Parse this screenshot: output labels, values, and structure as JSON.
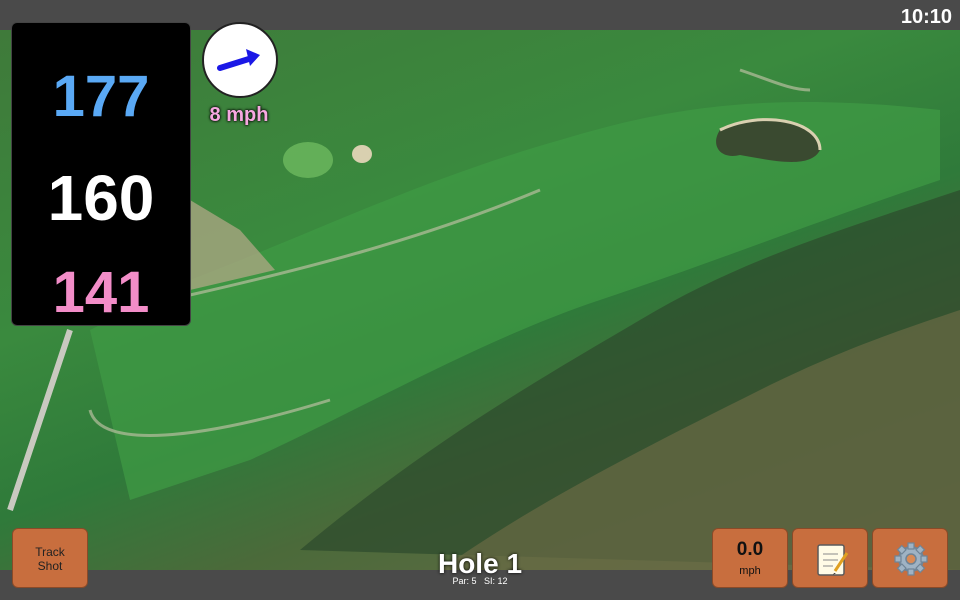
{
  "status": {
    "time": "10:10"
  },
  "distances": {
    "back": "177",
    "middle": "160",
    "front": "141"
  },
  "wind": {
    "speed": "8 mph",
    "icon": "arrow-right-icon",
    "arrow_color": "#1b18e6"
  },
  "buttons": {
    "track_shot": "Track\nShot",
    "speed_value": "0.0",
    "speed_unit": "mph",
    "notes_icon": "notepad-icon",
    "settings_icon": "gear-icon"
  },
  "hole": {
    "title": "Hole 1",
    "par_label": "Par: 5",
    "si_label": "SI: 12"
  },
  "colors": {
    "button": "#c86e3e",
    "back": "#5aa9f5",
    "front": "#f28dc8"
  }
}
